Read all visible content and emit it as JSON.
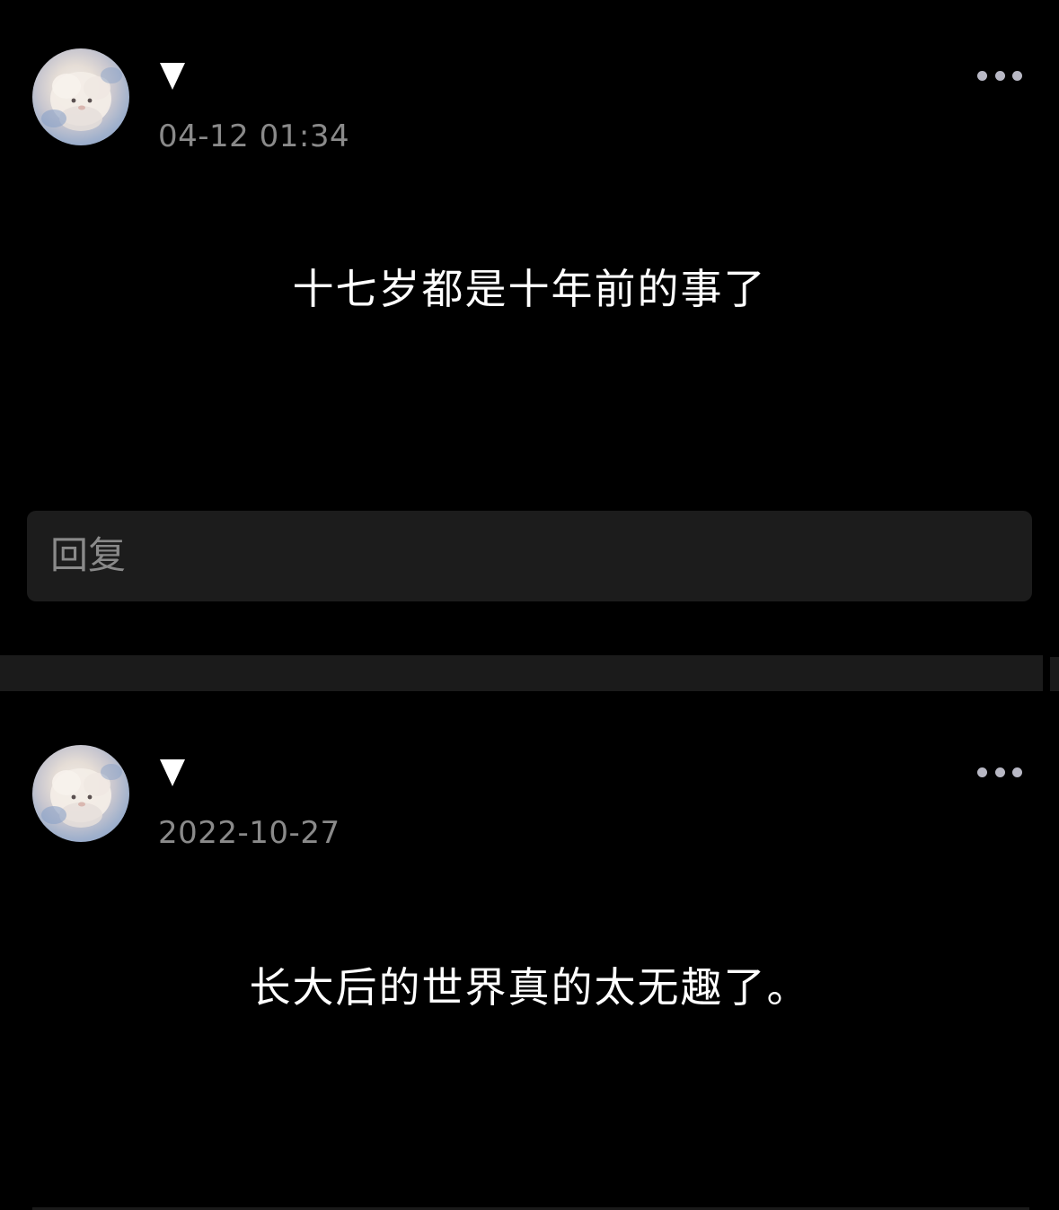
{
  "posts": [
    {
      "username_icon": "down-triangle-icon",
      "timestamp": "04-12 01:34",
      "content": "十七岁都是十年前的事了",
      "more_icon": "more-dots-icon",
      "avatar_icon": "fluffy-cloud-creature-avatar"
    },
    {
      "username_icon": "down-triangle-icon",
      "timestamp": "2022-10-27",
      "content": "长大后的世界真的太无趣了。",
      "more_icon": "more-dots-icon",
      "avatar_icon": "fluffy-cloud-creature-avatar"
    }
  ],
  "reply": {
    "placeholder": "回复"
  },
  "colors": {
    "background": "#000000",
    "reply_box": "#1c1c1c",
    "divider": "#1b1b1b",
    "timestamp": "#8a8a8a",
    "more_dots": "#b8b8c4"
  }
}
